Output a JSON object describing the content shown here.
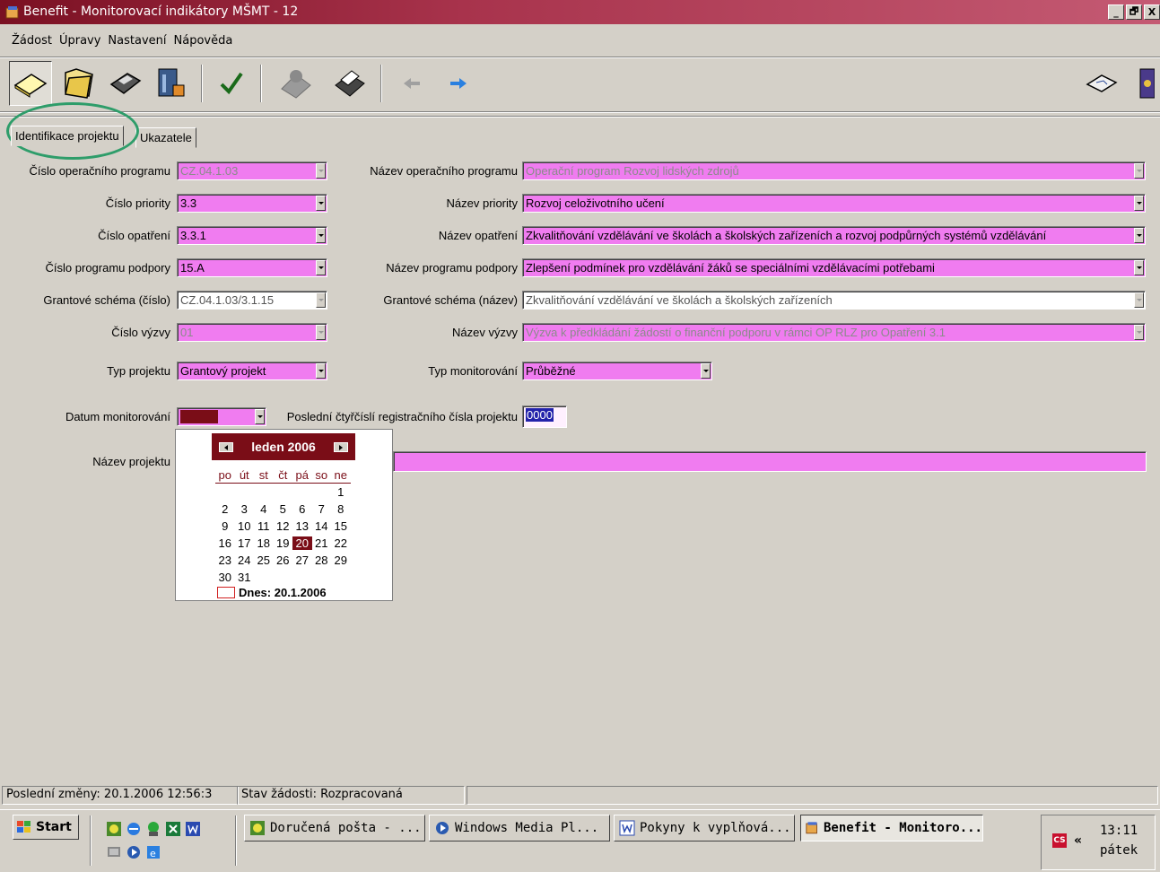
{
  "window": {
    "title": "Benefit - Monitorovací indikátory MŠMT - 12",
    "buttons": [
      "_",
      "🗗",
      "X"
    ]
  },
  "menu": [
    "Žádost",
    "Úpravy",
    "Nastavení",
    "Nápověda"
  ],
  "toolbar": {
    "icons": [
      "new-document-icon",
      "open-folder-icon",
      "save-disk-icon",
      "archive-icon",
      "check-icon",
      "stamp-icon",
      "print-icon",
      "back-arrow-icon",
      "forward-arrow-icon",
      "sign-document-icon",
      "help-book-icon"
    ]
  },
  "tabs": [
    {
      "label": "Identifikace projektu",
      "active": true
    },
    {
      "label": "Ukazatele",
      "active": false
    }
  ],
  "form": {
    "cislo_op": {
      "label": "Číslo operačního programu",
      "value": "CZ.04.1.03"
    },
    "nazev_op": {
      "label": "Název operačního programu",
      "value": "Operační program Rozvoj lidských zdrojů"
    },
    "cislo_priority": {
      "label": "Číslo priority",
      "value": "3.3"
    },
    "nazev_priority": {
      "label": "Název priority",
      "value": "Rozvoj celoživotního učení"
    },
    "cislo_opatreni": {
      "label": "Číslo opatření",
      "value": "3.3.1"
    },
    "nazev_opatreni": {
      "label": "Název opatření",
      "value": "Zkvalitňování vzdělávání ve školách a školských zařízeních a rozvoj podpůrných systémů vzdělávání"
    },
    "cislo_pp": {
      "label": "Číslo programu podpory",
      "value": "15.A"
    },
    "nazev_pp": {
      "label": "Název programu podpory",
      "value": "Zlepšení podmínek pro vzdělávání žáků se speciálními vzdělávacími potřebami"
    },
    "gs_cislo": {
      "label": "Grantové schéma (číslo)",
      "value": "CZ.04.1.03/3.1.15"
    },
    "gs_nazev": {
      "label": "Grantové schéma (název)",
      "value": "Zkvalitňování vzdělávání ve školách a školských zařízeních"
    },
    "cislo_vyzvy": {
      "label": "Číslo výzvy",
      "value": "01"
    },
    "nazev_vyzvy": {
      "label": "Název výzvy",
      "value": "Výzva k předkládání žádostí o finanční podporu v rámci OP RLZ pro Opatření 3.1"
    },
    "typ_projektu": {
      "label": "Typ projektu",
      "value": "Grantový projekt"
    },
    "typ_monitorovani": {
      "label": "Typ monitorování",
      "value": "Průběžné"
    },
    "datum_monitorovani": {
      "label": "Datum monitorování",
      "value": ". . ."
    },
    "posledni_ctyrcisli": {
      "label": "Poslední čtyřčíslí registračního čísla projektu",
      "value": "0000"
    },
    "nazev_projektu": {
      "label": "Název projektu",
      "value": ""
    }
  },
  "calendar": {
    "month_label": "leden 2006",
    "weekdays": [
      "po",
      "út",
      "st",
      "čt",
      "pá",
      "so",
      "ne"
    ],
    "weeks": [
      [
        "",
        "",
        "",
        "",
        "",
        "",
        "1"
      ],
      [
        "2",
        "3",
        "4",
        "5",
        "6",
        "7",
        "8"
      ],
      [
        "9",
        "10",
        "11",
        "12",
        "13",
        "14",
        "15"
      ],
      [
        "16",
        "17",
        "18",
        "19",
        "20",
        "21",
        "22"
      ],
      [
        "23",
        "24",
        "25",
        "26",
        "27",
        "28",
        "29"
      ],
      [
        "30",
        "31",
        "",
        "",
        "",
        "",
        ""
      ]
    ],
    "selected_day": "20",
    "today_label": "Dnes: 20.1.2006"
  },
  "statusbar": {
    "last_change": "Poslední změny: 20.1.2006 12:56:3",
    "state": "Stav žádosti: Rozpracovaná"
  },
  "taskbar": {
    "start_label": "Start",
    "tasks": [
      {
        "label": "Doručená pošta - ...",
        "icon": "outlook-icon"
      },
      {
        "label": "Windows Media Pl...",
        "icon": "media-player-icon"
      },
      {
        "label": "Pokyny k vyplňová...",
        "icon": "word-icon"
      },
      {
        "label": "Benefit - Monitoro...",
        "icon": "benefit-icon",
        "active": true
      }
    ],
    "tray_lang": "CS",
    "clock_time": "13:11",
    "clock_day": "pátek"
  },
  "colors": {
    "field_pink": "#f07cf0",
    "accent_dark_red": "#7a0d17",
    "highlight_circle": "#2e9d6a"
  }
}
